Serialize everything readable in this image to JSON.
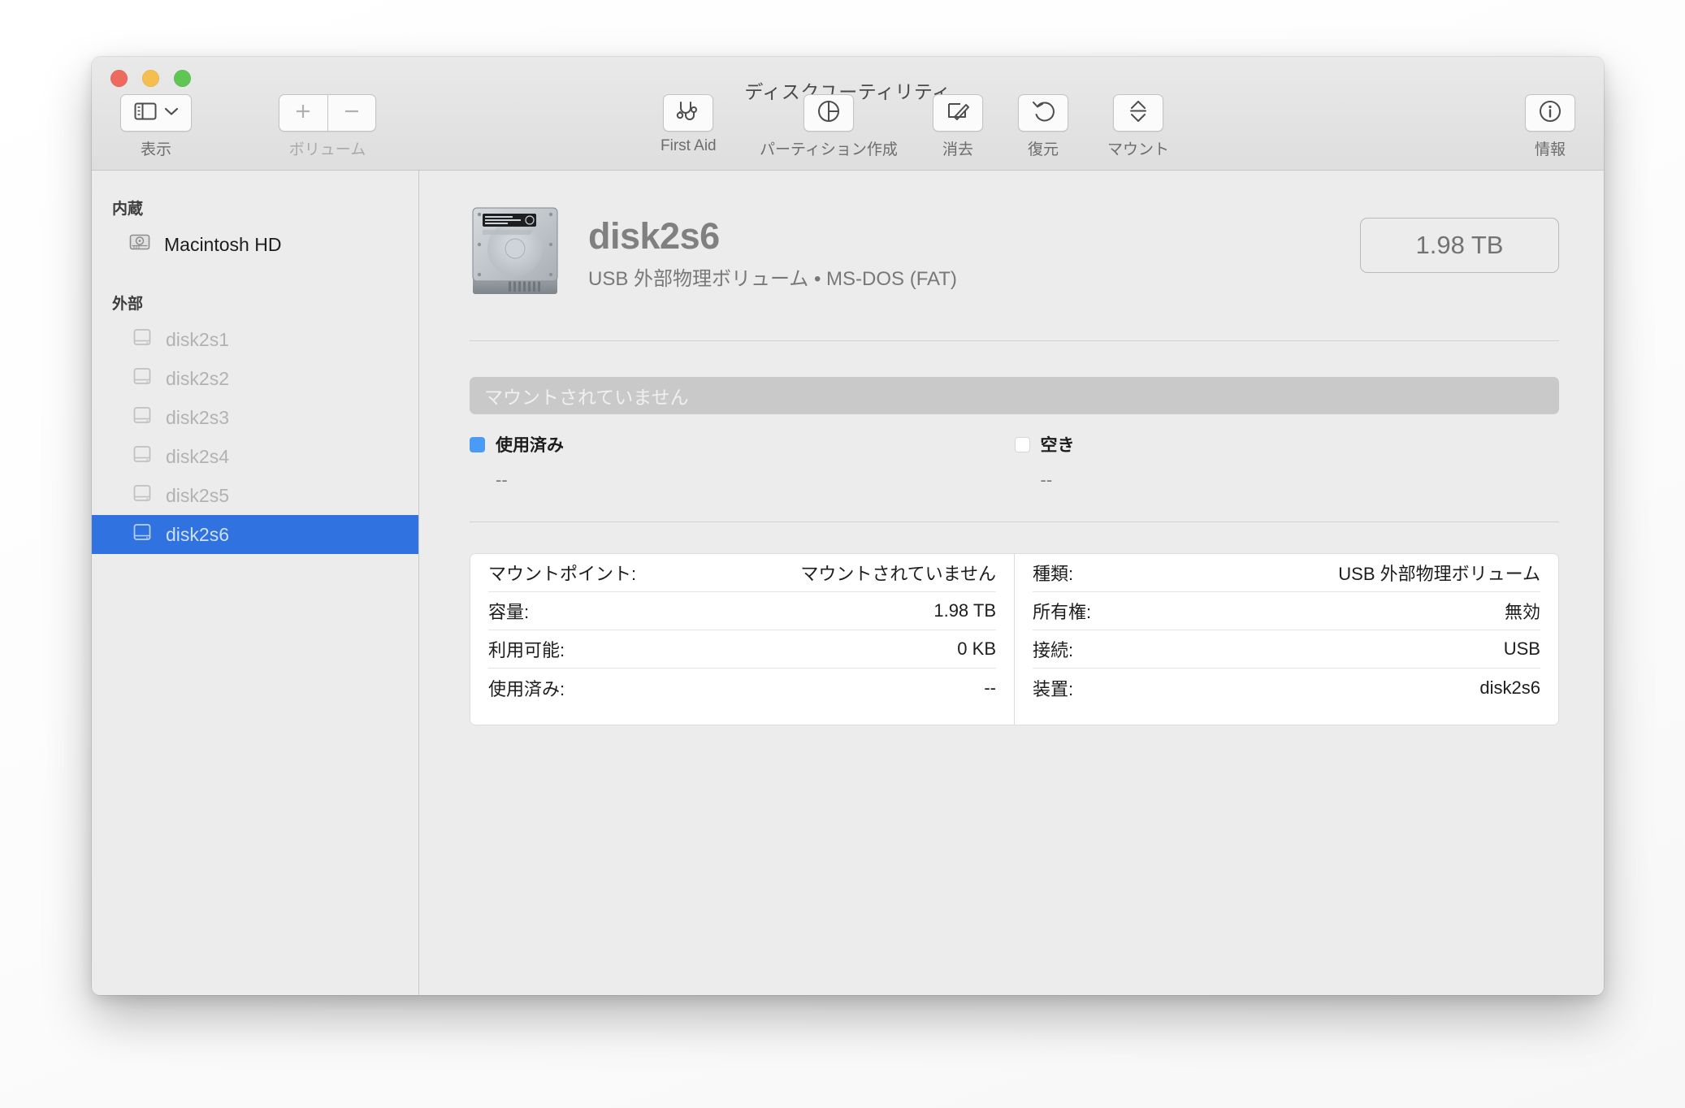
{
  "window": {
    "title": "ディスクユーティリティ",
    "traffic_lights": [
      "close-button",
      "minimize-button",
      "zoom-button"
    ]
  },
  "toolbar": {
    "view": {
      "label": "表示",
      "icon": "sidebar-view-icon",
      "chevron": "chevron-down-icon"
    },
    "volume": {
      "label": "ボリューム",
      "add_icon": "plus-icon",
      "remove_icon": "minus-icon"
    },
    "actions": [
      {
        "label": "First Aid",
        "icon": "stethoscope-icon"
      },
      {
        "label": "パーティション作成",
        "icon": "partition-pie-icon"
      },
      {
        "label": "消去",
        "icon": "erase-pencil-icon"
      },
      {
        "label": "復元",
        "icon": "restore-undo-icon"
      },
      {
        "label": "マウント",
        "icon": "mount-eject-icon"
      }
    ],
    "info": {
      "label": "情報",
      "icon": "info-circle-icon"
    }
  },
  "sidebar": {
    "sections": [
      {
        "heading": "内蔵",
        "items": [
          {
            "label": "Macintosh HD",
            "icon": "internal-drive-icon",
            "state": "normal"
          }
        ]
      },
      {
        "heading": "外部",
        "items": [
          {
            "label": "disk2s1",
            "icon": "external-drive-icon",
            "state": "dim"
          },
          {
            "label": "disk2s2",
            "icon": "external-drive-icon",
            "state": "dim"
          },
          {
            "label": "disk2s3",
            "icon": "external-drive-icon",
            "state": "dim"
          },
          {
            "label": "disk2s4",
            "icon": "external-drive-icon",
            "state": "dim"
          },
          {
            "label": "disk2s5",
            "icon": "external-drive-icon",
            "state": "dim"
          },
          {
            "label": "disk2s6",
            "icon": "external-drive-icon",
            "state": "selected"
          }
        ]
      }
    ],
    "selection_color": "#2f72e0"
  },
  "volume_header": {
    "icon": "hard-disk-icon",
    "name": "disk2s6",
    "subtitle": "USB 外部物理ボリューム • MS-DOS (FAT)",
    "capacity_badge": "1.98 TB"
  },
  "usage": {
    "bar_text": "マウントされていません",
    "bar_color": "#c9c9c9",
    "legend": [
      {
        "name": "使用済み",
        "value": "--",
        "color": "#4a9bf5"
      },
      {
        "name": "空き",
        "value": "--",
        "color": "#ffffff"
      }
    ]
  },
  "info_table": {
    "left": [
      {
        "key": "マウントポイント:",
        "value": "マウントされていません"
      },
      {
        "key": "容量:",
        "value": "1.98 TB"
      },
      {
        "key": "利用可能:",
        "value": "0 KB"
      },
      {
        "key": "使用済み:",
        "value": "--"
      }
    ],
    "right": [
      {
        "key": "種類:",
        "value": "USB 外部物理ボリューム"
      },
      {
        "key": "所有権:",
        "value": "無効"
      },
      {
        "key": "接続:",
        "value": "USB"
      },
      {
        "key": "装置:",
        "value": "disk2s6"
      }
    ]
  }
}
